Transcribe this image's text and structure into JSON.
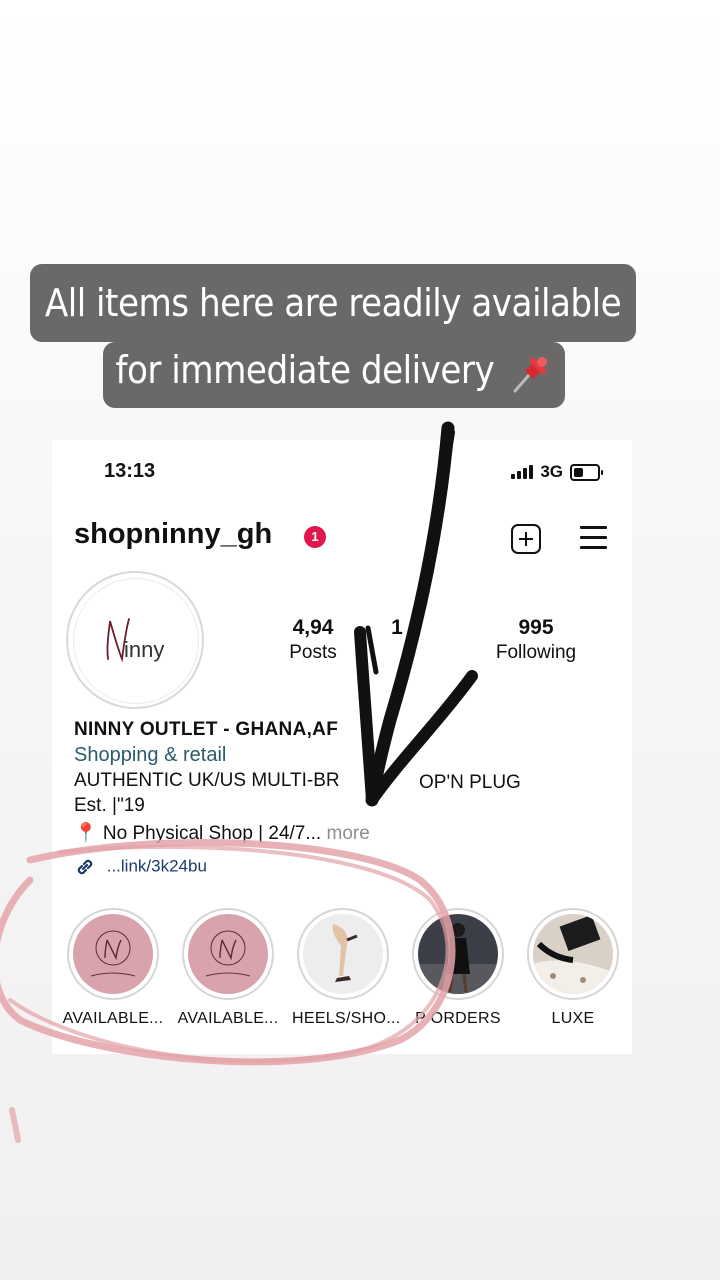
{
  "caption": {
    "line1": "All items here are readily available",
    "line2": "for immediate delivery"
  },
  "status_bar": {
    "time": "13:13",
    "network": "3G"
  },
  "profile": {
    "username": "shopninny_gh",
    "notification_count": "1",
    "avatar_text": "inny",
    "stats": [
      {
        "value": "4,94",
        "label": "Posts"
      },
      {
        "value": "1",
        "label": ""
      },
      {
        "value": "995",
        "label": "Following"
      }
    ],
    "bio": {
      "name": "NINNY OUTLET - GHANA,AF",
      "category": "Shopping & retail",
      "line1": "AUTHENTIC UK/US MULTI-BR",
      "line1_tail": "OP'N PLUG",
      "line2": "Est. |\"19",
      "line3": "📍 No Physical Shop | 24/7...",
      "more": "more",
      "link": "...link/3k24bu"
    }
  },
  "highlights": [
    {
      "label": "AVAILABLE...",
      "image": "ninny-outlet-logo"
    },
    {
      "label": "AVAILABLE...",
      "image": "ninny-outlet-logo"
    },
    {
      "label": "HEELS/SHO...",
      "image": "heels-photo"
    },
    {
      "label": "P   ORDERS",
      "image": "dress-photo"
    },
    {
      "label": "LUXE",
      "image": "luxe-photo"
    }
  ],
  "colors": {
    "caption_bg": "#6b6868",
    "notification": "#e0174a",
    "category": "#2c5b6b",
    "highlight_pink": "#d9a3ad",
    "circle_marker": "#e3a3a8",
    "arrow": "#111111"
  }
}
